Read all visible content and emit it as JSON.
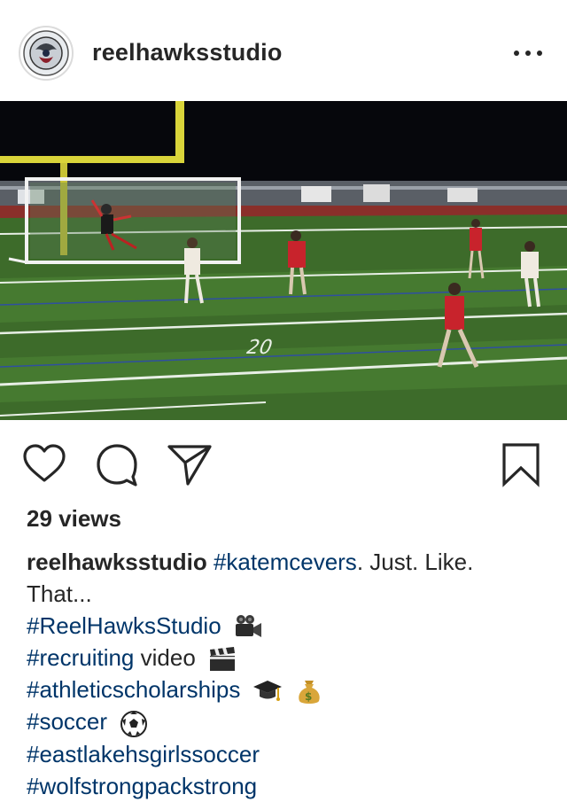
{
  "post": {
    "username": "reelhawksstudio",
    "views_text": "29 views"
  },
  "caption": {
    "username": "reelhawksstudio",
    "hashtag_1": "#katemcevers",
    "text_1": ". Just. Like.",
    "text_2": "That...",
    "hashtag_2": "#ReelHawksStudio",
    "hashtag_3": "#recruiting",
    "text_3": " video",
    "hashtag_4": "#athleticscholarships",
    "hashtag_5": "#soccer",
    "hashtag_6": "#eastlakehsgirlssoccer",
    "hashtag_7": "#wolfstrongpackstrong"
  },
  "icons": {
    "avatar": "hawk-logo-icon",
    "more": "more-options-icon",
    "like": "heart-icon",
    "comment": "comment-bubble-icon",
    "share": "paper-plane-icon",
    "save": "bookmark-icon",
    "emoji_1": "video-camera-icon",
    "emoji_2": "clapperboard-icon",
    "emoji_3": "graduation-cap-icon",
    "emoji_4": "money-bag-icon",
    "emoji_5": "soccer-ball-icon"
  },
  "colors": {
    "text": "#262626",
    "hashtag": "#003569",
    "field": "#3d6b2a"
  }
}
